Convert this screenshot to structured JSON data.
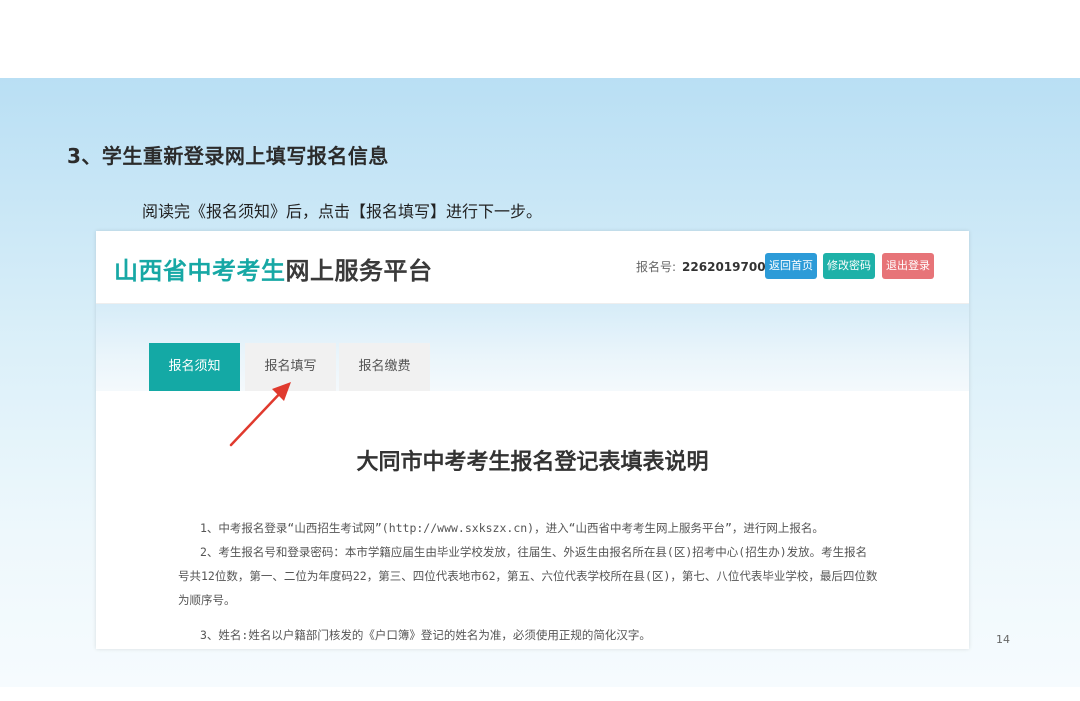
{
  "slide": {
    "heading": "3、学生重新登录网上填写报名信息",
    "instruction": "阅读完《报名须知》后，点击【报名填写】进行下一步。",
    "page_number": "14"
  },
  "portal": {
    "logo_accent": "山西省中考考生",
    "logo_rest": "网上服务平台",
    "reg_label": "报名号:",
    "reg_value": "226201970006",
    "buttons": {
      "home": "返回首页",
      "change_password": "修改密码",
      "logout": "退出登录"
    },
    "tabs": [
      "报名须知",
      "报名填写",
      "报名缴费"
    ],
    "active_tab": "报名须知",
    "doc": {
      "title": "大同市中考考生报名登记表填表说明",
      "paragraphs": [
        "1、中考报名登录“山西招生考试网”(http://www.sxkszx.cn)，进入“山西省中考考生网上服务平台”，进行网上报名。",
        "2、考生报名号和登录密码：本市学籍应届生由毕业学校发放，往届生、外返生由报名所在县(区)招考中心(招生办)发放。考生报名号共12位数，第一、二位为年度码22，第三、四位代表地市62，第五、六位代表学校所在县(区)，第七、八位代表毕业学校，最后四位数为顺序号。",
        "3、姓名:姓名以户籍部门核发的《户口簿》登记的姓名为准，必须使用正规的简化汉字。"
      ]
    }
  },
  "colors": {
    "teal": "#14a9a5",
    "blue_button": "#2c9bd8",
    "red_button": "#e77478",
    "arrow": "#e03a2e"
  }
}
